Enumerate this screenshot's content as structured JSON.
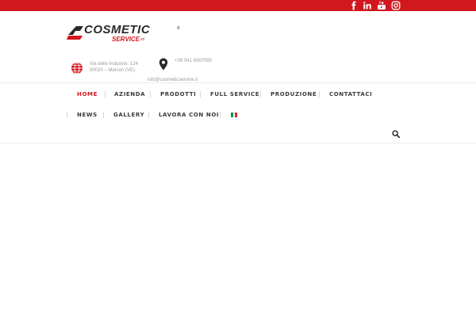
{
  "brand": {
    "name": "COSMETIC",
    "registered": "®",
    "sub": "SERVICE",
    "suffix": "srl",
    "red": "#d0181e",
    "dark": "#2a2a2a"
  },
  "social": [
    {
      "icon": "facebook-icon",
      "glyph": "f"
    },
    {
      "icon": "linkedin-icon",
      "glyph": "in"
    },
    {
      "icon": "youtube-icon",
      "glyph": "yt"
    },
    {
      "icon": "instagram-icon",
      "glyph": "ig"
    }
  ],
  "contact": {
    "address_line1": "Via delle Industrie, 124",
    "address_line2": "30020 – Marcon (VE)",
    "phone": "+39 041 4567050",
    "email": "info@cosmeticservice.it"
  },
  "nav": {
    "row1": [
      "HOME",
      "AZIENDA",
      "PRODOTTI",
      "FULL SERVICE",
      "PRODUZIONE",
      "CONTATTACI"
    ],
    "row2": [
      "NEWS",
      "GALLERY",
      "LAVORA CON NOI"
    ],
    "active": "HOME",
    "language_flag": "italian-flag-icon"
  },
  "colors": {
    "topbar": "#d0181e",
    "active_nav": "#d0181e",
    "nav_text": "#3a3a3a",
    "contact_text": "#9a9a9a",
    "flag": [
      "#009246",
      "#ffffff",
      "#ce2b37"
    ]
  }
}
